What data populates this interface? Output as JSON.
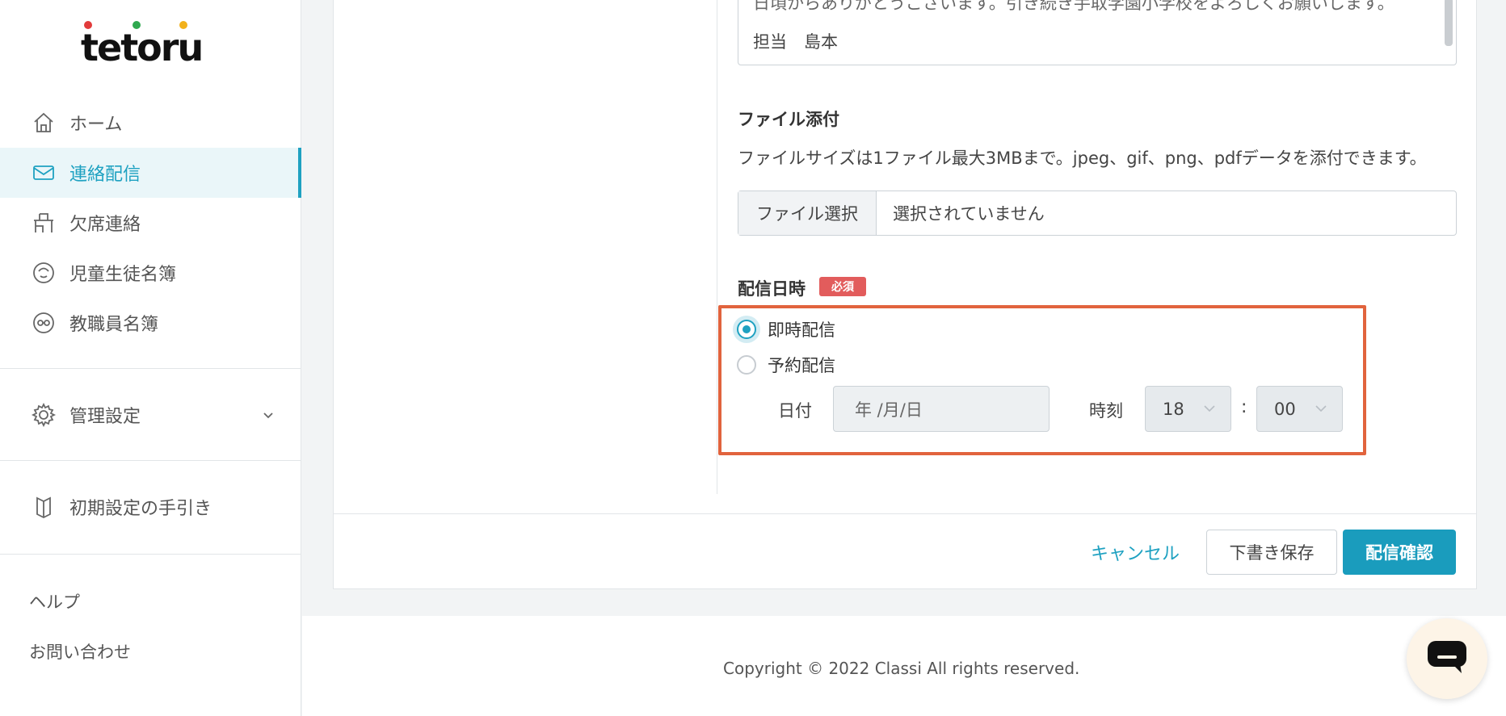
{
  "app": {
    "logo_text": "tetoru",
    "logo_dot_colors": [
      "#e23b3b",
      "#2fa84f",
      "#f2b11b"
    ],
    "accent": "#1ea1c1"
  },
  "sidebar": {
    "items": [
      {
        "label": "ホーム",
        "icon": "home-icon"
      },
      {
        "label": "連絡配信",
        "icon": "mail-icon",
        "active": true
      },
      {
        "label": "欠席連絡",
        "icon": "desk-icon"
      },
      {
        "label": "児童生徒名簿",
        "icon": "student-face-icon"
      },
      {
        "label": "教職員名簿",
        "icon": "teacher-face-icon"
      }
    ],
    "settings_label": "管理設定",
    "guide_label": "初期設定の手引き",
    "help_label": "ヘルプ",
    "contact_label": "お問い合わせ"
  },
  "form": {
    "message_line1": "日頃からありがとうございます。引き続き手取学園小学校をよろしくお願いします。",
    "message_line2": "担当　島本",
    "attachment": {
      "title": "ファイル添付",
      "description": "ファイルサイズは1ファイル最大3MBまで。jpeg、gif、png、pdfデータを添付できます。",
      "button_label": "ファイル選択",
      "file_status": "選択されていません"
    },
    "schedule": {
      "title": "配信日時",
      "required_badge": "必須",
      "option_immediate": "即時配信",
      "option_scheduled": "予約配信",
      "selected": "immediate",
      "date_label": "日付",
      "date_placeholder": "年 /月/日",
      "time_label": "時刻",
      "hour": "18",
      "minute": "00",
      "colon": ":"
    }
  },
  "actions": {
    "cancel": "キャンセル",
    "save_draft": "下書き保存",
    "confirm": "配信確認"
  },
  "footer": {
    "copyright": "Copyright © 2022 Classi All rights reserved."
  }
}
